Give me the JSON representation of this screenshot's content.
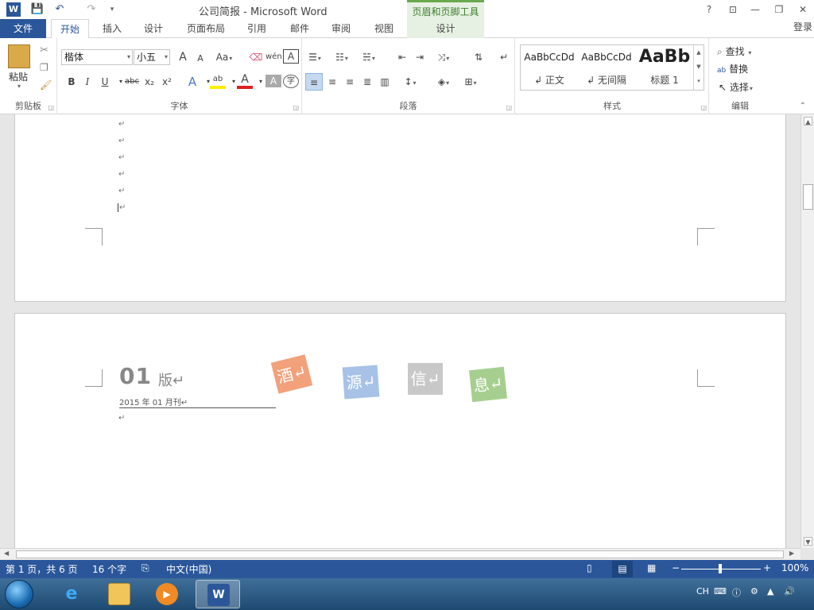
{
  "titlebar": {
    "logo": "W",
    "qa_save": "💾",
    "qa_undo": "↶",
    "qa_redo": "↷",
    "qa_customize": "▾",
    "title": "公司简报 - Microsoft Word",
    "context_title": "页眉和页脚工具",
    "help": "?",
    "ribbon_display": "⊡",
    "minimize": "—",
    "restore": "❐",
    "close": "✕"
  },
  "tabs": {
    "file": "文件",
    "items": [
      "开始",
      "插入",
      "设计",
      "页面布局",
      "引用",
      "邮件",
      "审阅",
      "视图"
    ],
    "context_tab": "设计",
    "login": "登录"
  },
  "ribbon": {
    "clipboard": {
      "label": "剪贴板",
      "paste": "粘贴"
    },
    "font": {
      "label": "字体",
      "font_name": "楷体",
      "font_size": "小五",
      "grow": "A",
      "shrink": "A",
      "case": "Aa",
      "bold": "B",
      "italic": "I",
      "underline": "U",
      "strike": "abc",
      "subscript": "x₂",
      "superscript": "x²",
      "char_border": "A",
      "phonetic": "wén",
      "char_circle": "字"
    },
    "paragraph": {
      "label": "段落"
    },
    "styles": {
      "label": "样式",
      "items": [
        {
          "sample": "AaBbCcDd",
          "name": "↲ 正文"
        },
        {
          "sample": "AaBbCcDd",
          "name": "↲ 无间隔"
        },
        {
          "sample": "AaBb",
          "name": "标题 1"
        }
      ]
    },
    "editing": {
      "label": "编辑",
      "find": "查找",
      "replace": "替换",
      "select": "选择"
    }
  },
  "document": {
    "paragraph_mark": "↵",
    "issue_number": "01",
    "issue_ban": "版↵",
    "issue_date": "2015 年 01 月刊↵",
    "tiles": [
      {
        "char": "酒↵",
        "color": "#f2a17a"
      },
      {
        "char": "源↵",
        "color": "#a7c2e6"
      },
      {
        "char": "信↵",
        "color": "#c8c8c8"
      },
      {
        "char": "息↵",
        "color": "#a6cf8f"
      }
    ]
  },
  "statusbar": {
    "page": "第 1 页，共 6 页",
    "words": "16 个字",
    "language": "中文(中国)",
    "zoom": "100%",
    "zoom_minus": "−",
    "zoom_plus": "+"
  },
  "taskbar": {
    "tray_lang": "CH"
  },
  "colors": {
    "accent": "#2b579a",
    "context_green": "#e7f1e3"
  }
}
